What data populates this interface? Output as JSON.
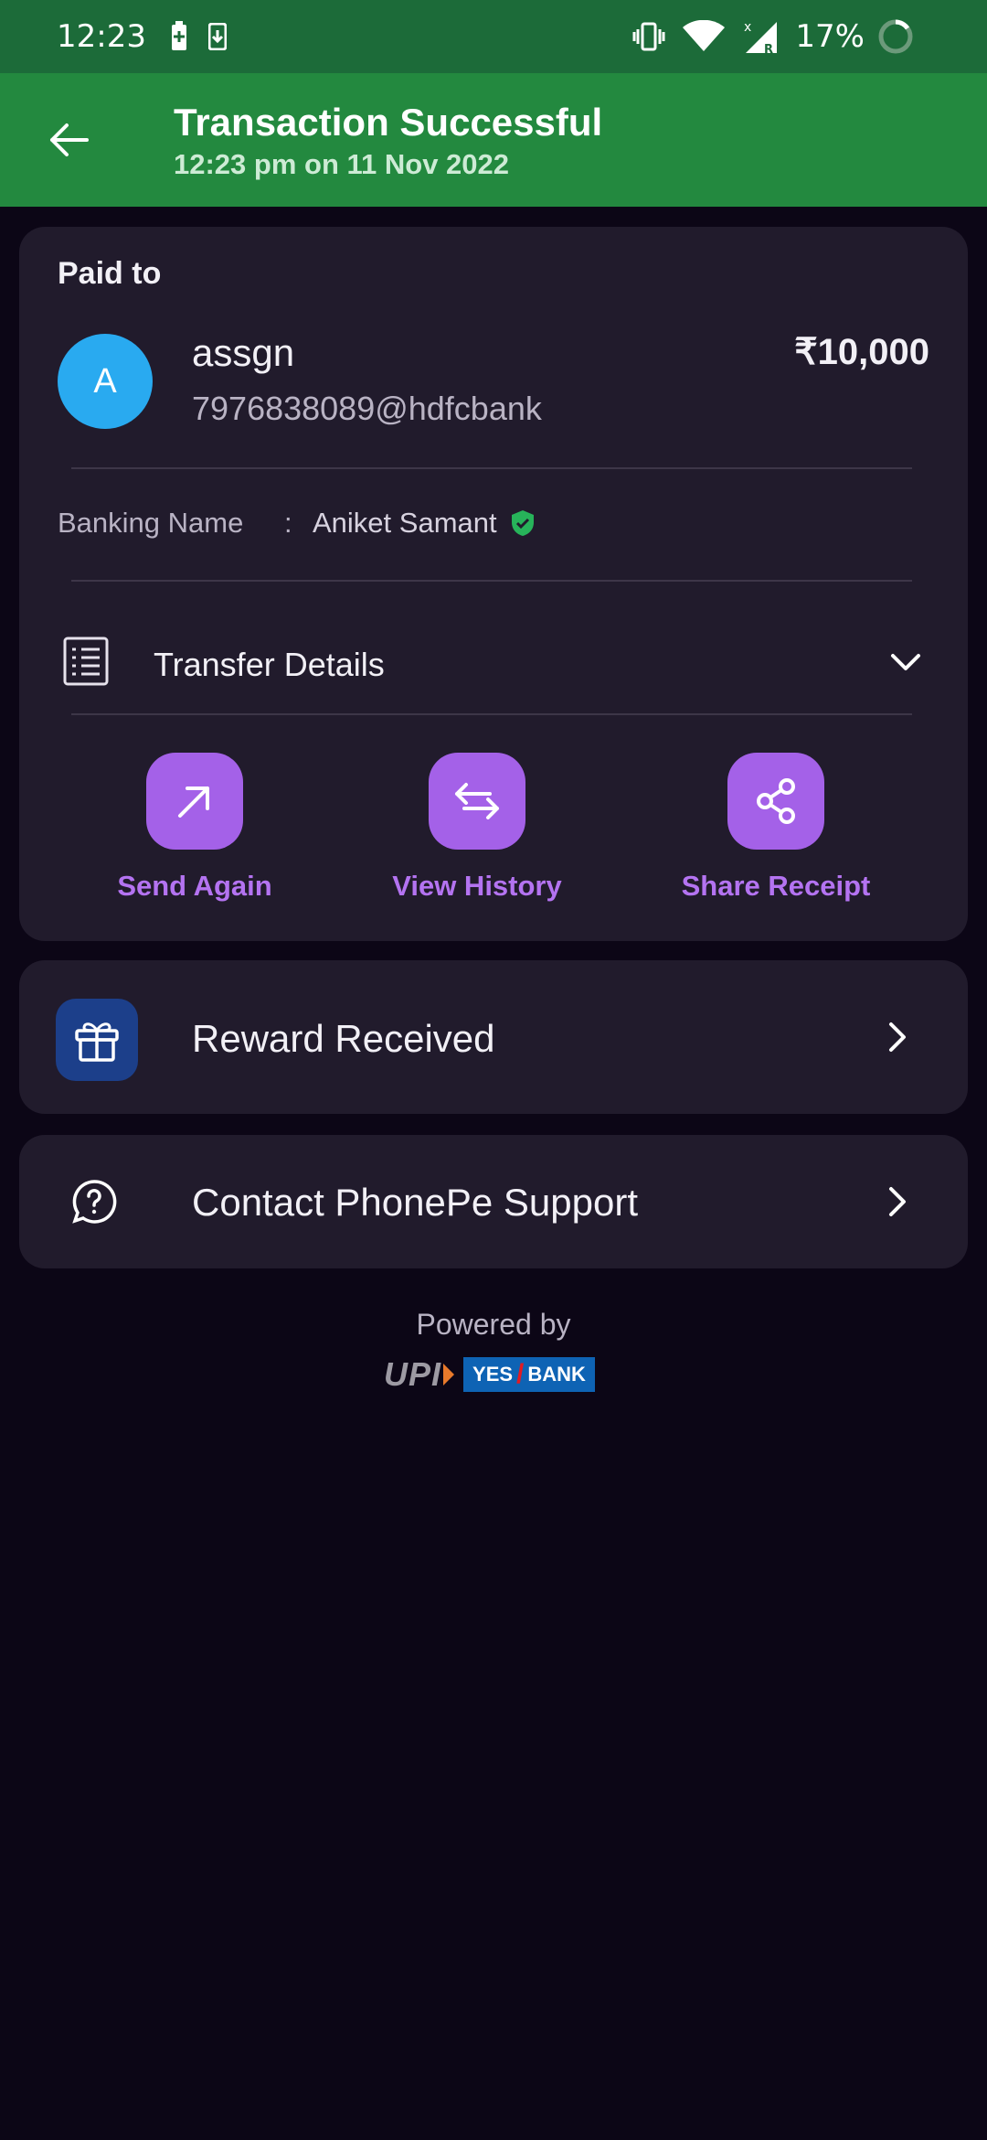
{
  "status_bar": {
    "time": "12:23",
    "battery_percent": "17%",
    "icons": [
      "battery-saver-icon",
      "download-icon",
      "vibrate-icon",
      "wifi-icon",
      "signal-icon",
      "battery-ring-icon"
    ]
  },
  "header": {
    "title": "Transaction Successful",
    "subtitle": "12:23 pm on 11 Nov 2022",
    "back_icon": "arrow-left-icon"
  },
  "payment": {
    "paid_to_label": "Paid to",
    "avatar_initial": "A",
    "payee_name": "assgn",
    "payee_upi": "7976838089@hdfcbank",
    "amount": "₹10,000",
    "banking_name_label": "Banking Name",
    "banking_name_separator": ":",
    "banking_name_value": "Aniket Samant"
  },
  "transfer_details": {
    "label": "Transfer Details",
    "icon": "receipt-icon"
  },
  "actions": [
    {
      "label": "Send Again",
      "icon": "arrow-up-right-icon"
    },
    {
      "label": "View History",
      "icon": "swap-arrows-icon"
    },
    {
      "label": "Share Receipt",
      "icon": "share-icon"
    }
  ],
  "reward": {
    "label": "Reward Received",
    "icon": "gift-icon"
  },
  "support": {
    "label": "Contact PhonePe Support",
    "icon": "help-circle-icon"
  },
  "footer": {
    "powered_by": "Powered by",
    "upi_logo": "UPI",
    "bank_logo_left": "YES",
    "bank_logo_right": "BANK"
  },
  "colors": {
    "status_bar": "#1c6b39",
    "app_bar": "#23893f",
    "background": "#0c0616",
    "card": "#211b2c",
    "accent_purple": "#a461e8",
    "avatar": "#29aaf0"
  }
}
